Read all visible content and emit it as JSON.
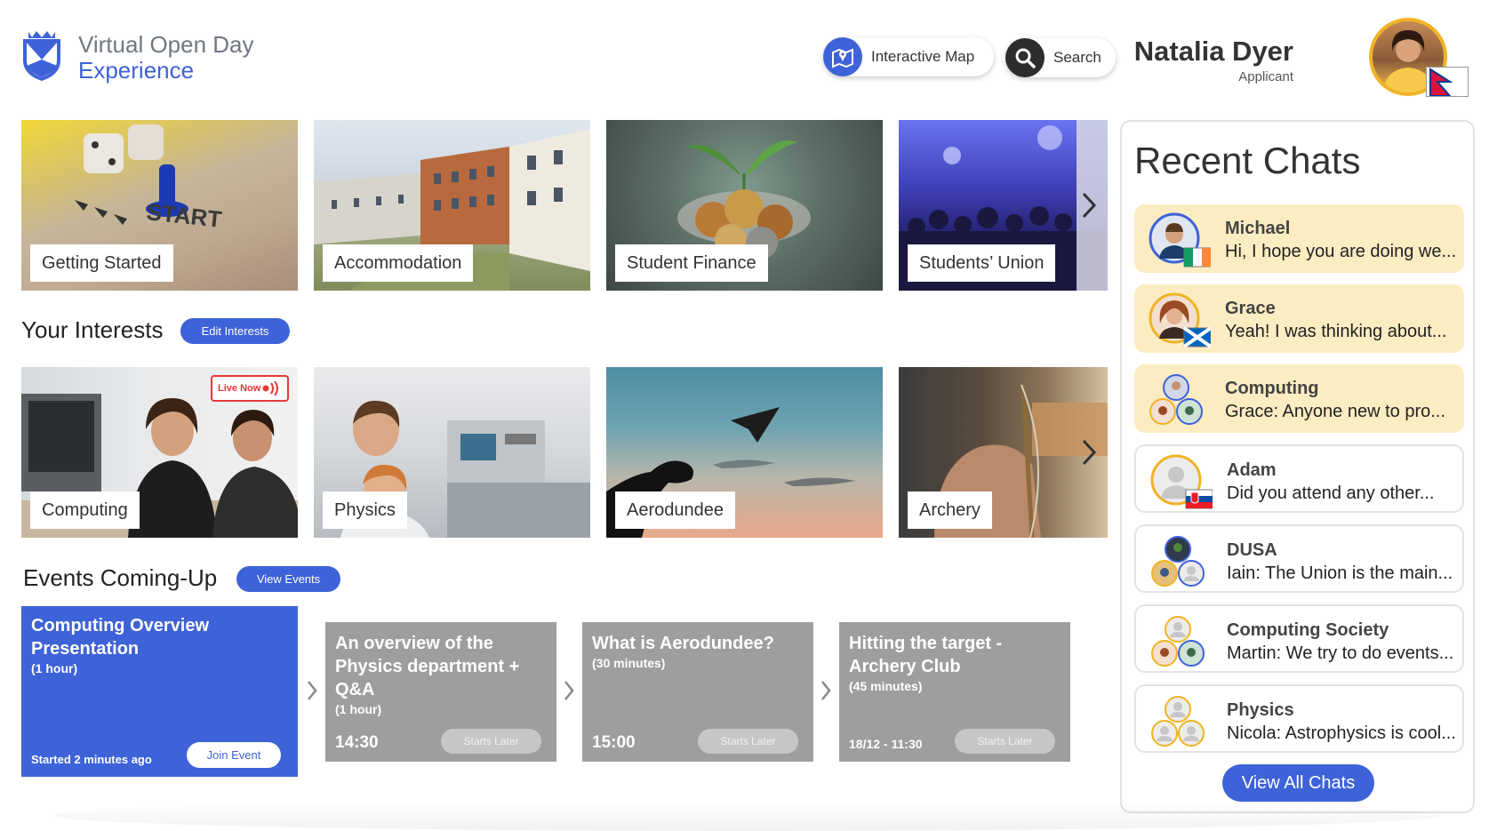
{
  "app": {
    "title_line1": "Virtual Open Day",
    "title_line2": "Experience"
  },
  "header": {
    "map_label": "Interactive Map",
    "search_label": "Search",
    "user_name": "Natalia Dyer",
    "user_role": "Applicant"
  },
  "topics": [
    {
      "label": "Getting Started"
    },
    {
      "label": "Accommodation"
    },
    {
      "label": "Student Finance"
    },
    {
      "label": "Students’ Union"
    }
  ],
  "interests": {
    "title": "Your Interests",
    "edit_label": "Edit Interests",
    "live_label": "Live Now",
    "items": [
      {
        "label": "Computing"
      },
      {
        "label": "Physics"
      },
      {
        "label": "Aerodundee"
      },
      {
        "label": "Archery"
      }
    ]
  },
  "events": {
    "title": "Events Coming-Up",
    "view_label": "View Events",
    "items": [
      {
        "title": "Computing Overview Presentation",
        "duration": "(1 hour)",
        "status": "Started 2 minutes ago",
        "action": "Join Event"
      },
      {
        "title": "An overview of the Physics department + Q&A",
        "duration": "(1 hour)",
        "time": "14:30",
        "action": "Starts Later"
      },
      {
        "title": "What is Aerodundee?",
        "duration": "(30 minutes)",
        "time": "15:00",
        "action": "Starts Later"
      },
      {
        "title": "Hitting the target - Archery Club",
        "duration": "(45 minutes)",
        "time": "18/12 - 11:30",
        "action": "Starts Later"
      }
    ]
  },
  "chats": {
    "title": "Recent Chats",
    "view_all_label": "View All Chats",
    "items": [
      {
        "name": "Michael",
        "message": "Hi, I hope you are doing we...",
        "unread": true
      },
      {
        "name": "Grace",
        "message": "Yeah! I was thinking about...",
        "unread": true
      },
      {
        "name": "Computing",
        "message": "Grace: Anyone new to pro...",
        "unread": true
      },
      {
        "name": "Adam",
        "message": "Did you attend any other...",
        "unread": false
      },
      {
        "name": "DUSA",
        "message": "Iain: The Union is the main...",
        "unread": false
      },
      {
        "name": "Computing Society",
        "message": "Martin: We try to do events...",
        "unread": false
      },
      {
        "name": "Physics",
        "message": "Nicola: Astrophysics is cool...",
        "unread": false
      }
    ]
  },
  "colors": {
    "accent": "#3e62d8",
    "unread_bg": "#fcecc2",
    "event_grey": "#9e9e9e",
    "live_red": "#e53935"
  }
}
